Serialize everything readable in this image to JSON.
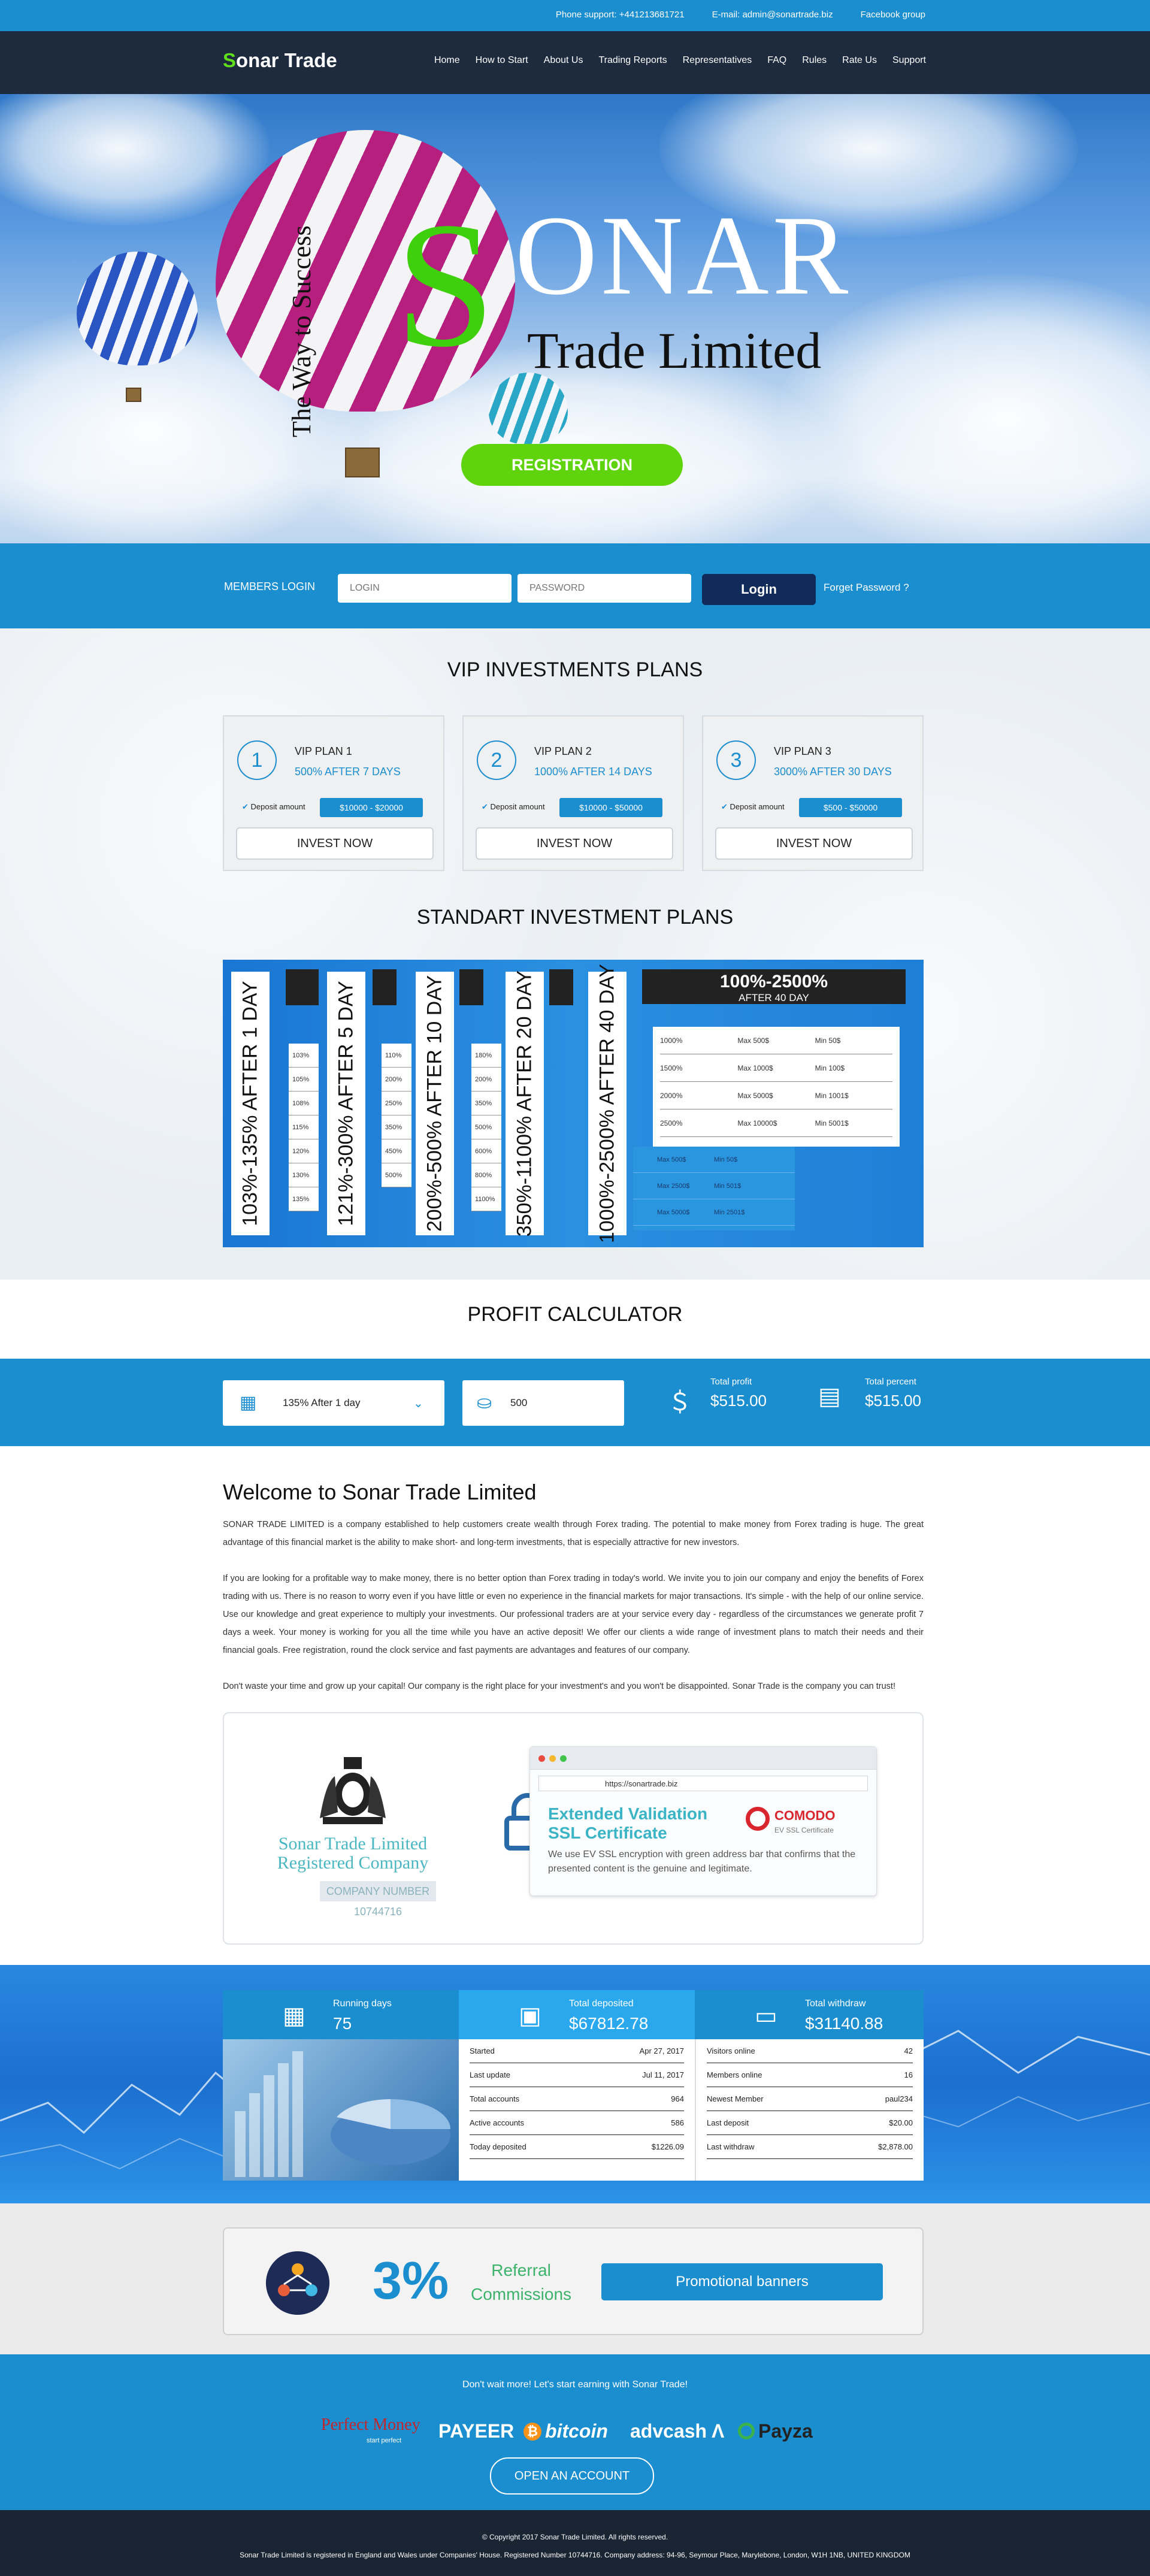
{
  "topbar": {
    "phone": "Phone support: +441213681721",
    "email": "E-mail: admin@sonartrade.biz",
    "facebook": "Facebook group"
  },
  "nav": {
    "logo_s": "S",
    "logo_rest": "onar Trade",
    "items": [
      "Home",
      "How to Start",
      "About Us",
      "Trading Reports",
      "Representatives",
      "FAQ",
      "Rules",
      "Rate Us",
      "Support"
    ]
  },
  "hero": {
    "tagline": "The Way to Success",
    "big_s": "S",
    "sonar": "ONAR",
    "trade_limited": "Trade Limited",
    "registration": "REGISTRATION"
  },
  "login": {
    "label": "MEMBERS LOGIN",
    "login_placeholder": "LOGIN",
    "password_placeholder": "PASSWORD",
    "button": "Login",
    "forgot": "Forget Password ?"
  },
  "vip": {
    "title": "VIP INVESTMENTS PLANS",
    "plans": [
      {
        "num": "1",
        "name": "VIP PLAN 1",
        "pct": "500% AFTER 7 DAYS",
        "deposit_label": "Deposit amount",
        "deposit": "$10000 - $20000",
        "invest": "INVEST NOW"
      },
      {
        "num": "2",
        "name": "VIP PLAN 2",
        "pct": "1000% AFTER 14 DAYS",
        "deposit_label": "Deposit amount",
        "deposit": "$10000 - $50000",
        "invest": "INVEST NOW"
      },
      {
        "num": "3",
        "name": "VIP PLAN 3",
        "pct": "3000% AFTER 30 DAYS",
        "deposit_label": "Deposit amount",
        "deposit": "$500 - $50000",
        "invest": "INVEST NOW"
      }
    ]
  },
  "standard": {
    "title": "STANDART INVESTMENT PLANS",
    "top_title": "100%-2500%",
    "top_sub": "AFTER 40 DAY",
    "verticals": [
      "103%-135% AFTER 1 DAY",
      "121%-300% AFTER 5 DAY",
      "200%-500% AFTER 10 DAY",
      "350%-1100% AFTER 20 DAY",
      "1000%-2500% AFTER 40 DAY"
    ],
    "col1": [
      "103%",
      "105%",
      "108%",
      "115%",
      "120%",
      "130%",
      "135%"
    ],
    "col2": [
      "110%",
      "200%",
      "250%",
      "350%",
      "450%",
      "500%"
    ],
    "col3": [
      "180%",
      "200%",
      "350%",
      "500%",
      "600%",
      "800%",
      "1100%"
    ],
    "big_rows": [
      [
        "1000%",
        "Max 500$",
        "Min 50$"
      ],
      [
        "1500%",
        "Max 1000$",
        "Min 100$"
      ],
      [
        "2000%",
        "Max 5000$",
        "Min 1001$"
      ],
      [
        "2500%",
        "Max 10000$",
        "Min 5001$"
      ]
    ],
    "low_rows": [
      [
        "Max 500$",
        "Min 50$"
      ],
      [
        "Max 2500$",
        "Min 501$"
      ],
      [
        "Max 5000$",
        "Min 2501$"
      ]
    ]
  },
  "calculator": {
    "title": "PROFIT CALCULATOR",
    "plan_select": "135% After 1 day",
    "amount": "500",
    "total_profit_label": "Total profit",
    "total_profit": "$515.00",
    "total_percent_label": "Total percent",
    "total_percent": "$515.00"
  },
  "welcome": {
    "title": "Welcome to Sonar Trade Limited",
    "p1": "SONAR TRADE LIMITED is a company established to help customers create wealth through Forex trading. The potential to make money from Forex trading is huge. The great advantage of this financial market is the ability to make short- and long-term investments, that is especially attractive for new investors.",
    "p2": "If you are looking for a profitable way to make money, there is no better option than Forex trading in today's world. We invite you to join our company and enjoy the benefits of Forex trading with us. There is no reason to worry even if you have little or even no experience in the financial markets for major transactions. It's simple - with the help of our online service. Use our knowledge and great experience to multiply your investments. Our professional traders are at your service every day - regardless of the circumstances we generate profit 7 days a week. Your money is working for you all the time while you have an active deposit! We offer our clients a wide range of investment plans to match their needs and their financial goals. Free registration, round the clock service and fast payments are advantages and features of our company.",
    "p3": "Don't waste your time and grow up your capital! Our company is the right place for your investment's and you won't be disappointed. Sonar Trade is the company you can trust!"
  },
  "cert": {
    "company_line1": "Sonar Trade Limited",
    "company_line2": "Registered Company",
    "company_number": "COMPANY NUMBER 10744716",
    "url": "https://sonartrade.biz",
    "ev_line1": "Extended Validation",
    "ev_line2": "SSL Certificate",
    "comodo": "COMODO",
    "comodo_sub": "EV SSL Certificate",
    "ev_desc": "We use EV SSL encryption with green address bar that confirms that the presented content is the genuine and legitimate."
  },
  "stats": {
    "running_label": "Running days",
    "running_value": "75",
    "deposited_label": "Total deposited",
    "deposited_value": "$67812.78",
    "withdraw_label": "Total withdraw",
    "withdraw_value": "$31140.88",
    "left_rows": [
      [
        "Started",
        "Apr 27, 2017"
      ],
      [
        "Last update",
        "Jul 11, 2017"
      ],
      [
        "Total accounts",
        "964"
      ],
      [
        "Active accounts",
        "586"
      ],
      [
        "Today deposited",
        "$1226.09"
      ]
    ],
    "right_rows": [
      [
        "Visitors online",
        "42"
      ],
      [
        "Members online",
        "16"
      ],
      [
        "Newest Member",
        "paul234"
      ],
      [
        "Last deposit",
        "$20.00"
      ],
      [
        "Last withdraw",
        "$2,878.00"
      ]
    ]
  },
  "referral": {
    "pct": "3%",
    "line1": "Referral",
    "line2": "Commissions",
    "button": "Promotional banners"
  },
  "bottom": {
    "dont_wait": "Don't wait more! Let's start earning with Sonar Trade!",
    "perfect_money": "Perfect Money",
    "perfect_sub": "start perfect",
    "payeer": "PAYEER",
    "bitcoin": "bitcoin",
    "advcash": "advcash",
    "payza": "Payza",
    "open_account": "OPEN AN ACCOUNT"
  },
  "footer": {
    "copyright": "© Copyright 2017 Sonar Trade Limited. All rights reserved.",
    "registered": "Sonar Trade Limited is registered in England and Wales under Companies' House. Registered Number 10744716. Company address: 94-96, Seymour Place, Marylebone, London, W1H 1NB, UNITED KINGDOM"
  },
  "colors": {
    "accent": "#1b8ed0",
    "green": "#5fd40d",
    "navy": "#1e2b3e"
  }
}
